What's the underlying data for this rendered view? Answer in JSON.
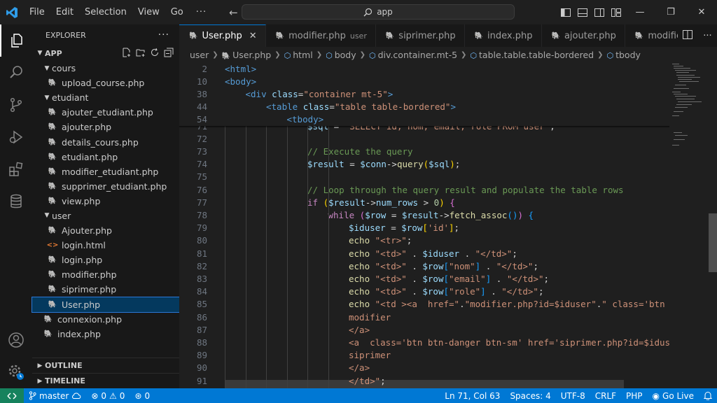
{
  "titlebar": {
    "menus": [
      "File",
      "Edit",
      "Selection",
      "View",
      "Go"
    ],
    "more": "···",
    "search_text": "app"
  },
  "sidebar": {
    "title": "EXPLORER",
    "more": "···",
    "root": "APP",
    "tree": [
      {
        "label": "cours",
        "type": "folder",
        "depth": 1
      },
      {
        "label": "upload_course.php",
        "type": "php",
        "depth": 2
      },
      {
        "label": "etudiant",
        "type": "folder",
        "depth": 1
      },
      {
        "label": "ajouter_etudiant.php",
        "type": "php",
        "depth": 2
      },
      {
        "label": "ajouter.php",
        "type": "php",
        "depth": 2
      },
      {
        "label": "details_cours.php",
        "type": "php",
        "depth": 2
      },
      {
        "label": "etudiant.php",
        "type": "php",
        "depth": 2
      },
      {
        "label": "modifier_etudiant.php",
        "type": "php",
        "depth": 2
      },
      {
        "label": "supprimer_etudiant.php",
        "type": "php",
        "depth": 2
      },
      {
        "label": "view.php",
        "type": "php",
        "depth": 2
      },
      {
        "label": "user",
        "type": "folder",
        "depth": 1
      },
      {
        "label": "Ajouter.php",
        "type": "php",
        "depth": 2
      },
      {
        "label": "login.html",
        "type": "html",
        "depth": 2
      },
      {
        "label": "login.php",
        "type": "php",
        "depth": 2
      },
      {
        "label": "modifier.php",
        "type": "php",
        "depth": 2
      },
      {
        "label": "siprimer.php",
        "type": "php",
        "depth": 2
      },
      {
        "label": "User.php",
        "type": "php",
        "depth": 2,
        "selected": true
      },
      {
        "label": "connexion.php",
        "type": "php",
        "depth": 1
      },
      {
        "label": "index.php",
        "type": "php",
        "depth": 1
      }
    ],
    "outline": "OUTLINE",
    "timeline": "TIMELINE"
  },
  "tabs": [
    {
      "label": "User.php",
      "active": true,
      "desc": ""
    },
    {
      "label": "modifier.php",
      "active": false,
      "desc": "user"
    },
    {
      "label": "siprimer.php",
      "active": false,
      "desc": ""
    },
    {
      "label": "index.php",
      "active": false,
      "desc": ""
    },
    {
      "label": "ajouter.php",
      "active": false,
      "desc": ""
    },
    {
      "label": "modifie",
      "active": false,
      "desc": ""
    }
  ],
  "breadcrumb": [
    "user",
    "User.php",
    "html",
    "body",
    "div.container.mt-5",
    "table.table.table-bordered",
    "tbody"
  ],
  "editor": {
    "sticky": [
      {
        "n": "2",
        "indent": 0,
        "tokens": [
          [
            "tag",
            "<html>"
          ]
        ]
      },
      {
        "n": "10",
        "indent": 0,
        "tokens": [
          [
            "tag",
            "<body>"
          ]
        ]
      },
      {
        "n": "38",
        "indent": 1,
        "tokens": [
          [
            "tag",
            "<div "
          ],
          [
            "attr",
            "class"
          ],
          [
            "def",
            "="
          ],
          [
            "str",
            "\"container mt-5\""
          ],
          [
            "tag",
            ">"
          ]
        ]
      },
      {
        "n": "44",
        "indent": 2,
        "tokens": [
          [
            "tag",
            "<table "
          ],
          [
            "attr",
            "class"
          ],
          [
            "def",
            "="
          ],
          [
            "str",
            "\"table table-bordered\""
          ],
          [
            "tag",
            ">"
          ]
        ]
      },
      {
        "n": "54",
        "indent": 3,
        "tokens": [
          [
            "tag",
            "<tbody>"
          ]
        ]
      }
    ],
    "lines": [
      {
        "n": "71",
        "indent": 4,
        "tokens": [
          [
            "var",
            "$sql"
          ],
          [
            "def",
            " = "
          ],
          [
            "str",
            "\"SELECT id, nom, email, role FROM user\""
          ],
          [
            "def",
            ";"
          ]
        ]
      },
      {
        "n": "72",
        "indent": 4,
        "tokens": []
      },
      {
        "n": "73",
        "indent": 4,
        "tokens": [
          [
            "cmt",
            "// Execute the query"
          ]
        ]
      },
      {
        "n": "74",
        "indent": 4,
        "tokens": [
          [
            "var",
            "$result"
          ],
          [
            "def",
            " = "
          ],
          [
            "var",
            "$conn"
          ],
          [
            "def",
            "->"
          ],
          [
            "fn",
            "query"
          ],
          [
            "brk",
            "("
          ],
          [
            "var",
            "$sql"
          ],
          [
            "brk",
            ")"
          ],
          [
            "def",
            ";"
          ]
        ]
      },
      {
        "n": "75",
        "indent": 4,
        "tokens": []
      },
      {
        "n": "76",
        "indent": 4,
        "tokens": [
          [
            "cmt",
            "// Loop through the query result and populate the table rows"
          ]
        ]
      },
      {
        "n": "77",
        "indent": 4,
        "tokens": [
          [
            "kw",
            "if "
          ],
          [
            "brk",
            "("
          ],
          [
            "var",
            "$result"
          ],
          [
            "def",
            "->"
          ],
          [
            "var",
            "num_rows"
          ],
          [
            "def",
            " > "
          ],
          [
            "num",
            "0"
          ],
          [
            "brk",
            ")"
          ],
          [
            "def",
            " "
          ],
          [
            "brk2",
            "{"
          ]
        ]
      },
      {
        "n": "78",
        "indent": 5,
        "tokens": [
          [
            "kw",
            "while "
          ],
          [
            "brk2",
            "("
          ],
          [
            "var",
            "$row"
          ],
          [
            "def",
            " = "
          ],
          [
            "var",
            "$result"
          ],
          [
            "def",
            "->"
          ],
          [
            "fn",
            "fetch_assoc"
          ],
          [
            "brk3",
            "()"
          ],
          [
            "brk2",
            ")"
          ],
          [
            "def",
            " "
          ],
          [
            "brk3",
            "{"
          ]
        ]
      },
      {
        "n": "79",
        "indent": 6,
        "tokens": [
          [
            "var",
            "$iduser"
          ],
          [
            "def",
            " = "
          ],
          [
            "var",
            "$row"
          ],
          [
            "brk",
            "["
          ],
          [
            "str",
            "'id'"
          ],
          [
            "brk",
            "]"
          ],
          [
            "def",
            ";"
          ]
        ]
      },
      {
        "n": "80",
        "indent": 6,
        "tokens": [
          [
            "fn",
            "echo "
          ],
          [
            "str",
            "\"<tr>\""
          ],
          [
            "def",
            ";"
          ]
        ]
      },
      {
        "n": "81",
        "indent": 6,
        "tokens": [
          [
            "fn",
            "echo "
          ],
          [
            "str",
            "\"<td>\""
          ],
          [
            "def",
            " . "
          ],
          [
            "var",
            "$iduser"
          ],
          [
            "def",
            " . "
          ],
          [
            "str",
            "\"</td>\""
          ],
          [
            "def",
            ";"
          ]
        ]
      },
      {
        "n": "82",
        "indent": 6,
        "tokens": [
          [
            "fn",
            "echo "
          ],
          [
            "str",
            "\"<td>\""
          ],
          [
            "def",
            " . "
          ],
          [
            "var",
            "$row"
          ],
          [
            "brk3",
            "["
          ],
          [
            "str",
            "\"nom\""
          ],
          [
            "brk3",
            "]"
          ],
          [
            "def",
            " . "
          ],
          [
            "str",
            "\"</td>\""
          ],
          [
            "def",
            ";"
          ]
        ]
      },
      {
        "n": "83",
        "indent": 6,
        "tokens": [
          [
            "fn",
            "echo "
          ],
          [
            "str",
            "\"<td>\""
          ],
          [
            "def",
            " . "
          ],
          [
            "var",
            "$row"
          ],
          [
            "brk3",
            "["
          ],
          [
            "str",
            "\"email\""
          ],
          [
            "brk3",
            "]"
          ],
          [
            "def",
            " . "
          ],
          [
            "str",
            "\"</td>\""
          ],
          [
            "def",
            ";"
          ]
        ]
      },
      {
        "n": "84",
        "indent": 6,
        "tokens": [
          [
            "fn",
            "echo "
          ],
          [
            "str",
            "\"<td>\""
          ],
          [
            "def",
            " . "
          ],
          [
            "var",
            "$row"
          ],
          [
            "brk3",
            "["
          ],
          [
            "str",
            "\"role\""
          ],
          [
            "brk3",
            "]"
          ],
          [
            "def",
            " . "
          ],
          [
            "str",
            "\"</td>\""
          ],
          [
            "def",
            ";"
          ]
        ]
      },
      {
        "n": "85",
        "indent": 6,
        "tokens": [
          [
            "fn",
            "echo "
          ],
          [
            "str",
            "\"<td ><a  href=\""
          ],
          [
            "def",
            "."
          ],
          [
            "str",
            "\"modifier.php?id=$iduser\""
          ],
          [
            "def",
            "."
          ],
          [
            "str",
            "\" class='btn b"
          ]
        ]
      },
      {
        "n": "86",
        "indent": 6,
        "tokens": [
          [
            "str",
            "modifier"
          ]
        ]
      },
      {
        "n": "87",
        "indent": 6,
        "tokens": [
          [
            "str",
            "</a>"
          ]
        ]
      },
      {
        "n": "88",
        "indent": 6,
        "tokens": [
          [
            "str",
            "<a  class='btn btn-danger btn-sm' href='siprimer.php?id=$iduse"
          ]
        ]
      },
      {
        "n": "89",
        "indent": 6,
        "tokens": [
          [
            "str",
            "siprimer"
          ]
        ]
      },
      {
        "n": "90",
        "indent": 6,
        "tokens": [
          [
            "str",
            "</a>"
          ]
        ]
      },
      {
        "n": "91",
        "indent": 6,
        "tokens": [
          [
            "str",
            "</td>\""
          ],
          [
            "def",
            ";"
          ]
        ]
      }
    ]
  },
  "statusbar": {
    "branch": "master",
    "errors": "0",
    "warnings": "0",
    "ports": "0",
    "position": "Ln 71, Col 63",
    "spaces": "Spaces: 4",
    "encoding": "UTF-8",
    "eol": "CRLF",
    "language": "PHP",
    "golive": "Go Live"
  },
  "colors": {
    "accent": "#0078d4",
    "statusbar": "#0078d4",
    "selection": "#04395e",
    "php_icon": "#9b8ec4"
  }
}
